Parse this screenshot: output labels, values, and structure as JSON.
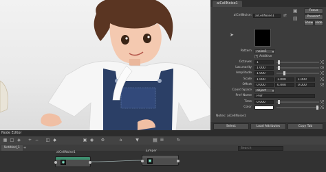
{
  "attribute_editor": {
    "tab": "aiCellNoise1",
    "node_type_label": "aiCellNoise:",
    "node_name": "aiCellNoise1",
    "focus_label": "Focus",
    "presets_label": "Presets*",
    "show_label": "Show",
    "hide_label": "Hide",
    "pattern_label": "Pattern",
    "pattern_value": "noise1",
    "additive_label": "Additive",
    "rows": [
      {
        "label": "Octaves",
        "value": "1"
      },
      {
        "label": "Lacunarity",
        "value": "1.000"
      },
      {
        "label": "Amplitude",
        "value": "1.000"
      },
      {
        "label": "Scale",
        "value": "1.000",
        "value2": "1.000",
        "value3": "1.000"
      },
      {
        "label": "Offset",
        "value": "0.000",
        "value2": "0.000",
        "value3": "0.000"
      }
    ],
    "coord_space_label": "Coord Space",
    "coord_space_value": "object",
    "pref_name_label": "Pref Name",
    "pref_name_value": "Pref",
    "time_label": "Time",
    "time_value": "0.000",
    "color_label": "Color",
    "notes_label": "Notes:",
    "notes_value": "aiCellNoise1",
    "select_label": "Select",
    "load_attrs_label": "Load Attributes",
    "copy_tab_label": "Copy Tab"
  },
  "node_editor": {
    "title": "Node Editor",
    "tab": "Untitled_1",
    "search_placeholder": "Search",
    "nodes": [
      {
        "name": "aiCellNoise1"
      },
      {
        "name": "jumper"
      }
    ],
    "toolbar_icons": [
      "grid-icon",
      "frame-icon",
      "graph-icon",
      "add-icon",
      "remove-icon",
      "layout-icon",
      "pin-icon",
      "lock-icon",
      "camera-icon",
      "settings-icon",
      "home-icon",
      "filter-icon",
      "view-icon",
      "list-icon",
      "refresh-icon"
    ]
  },
  "colors": {
    "panel": "#3c3c3c",
    "accent_node": "#3e8f6f",
    "viewport_bg": "#ececec"
  }
}
